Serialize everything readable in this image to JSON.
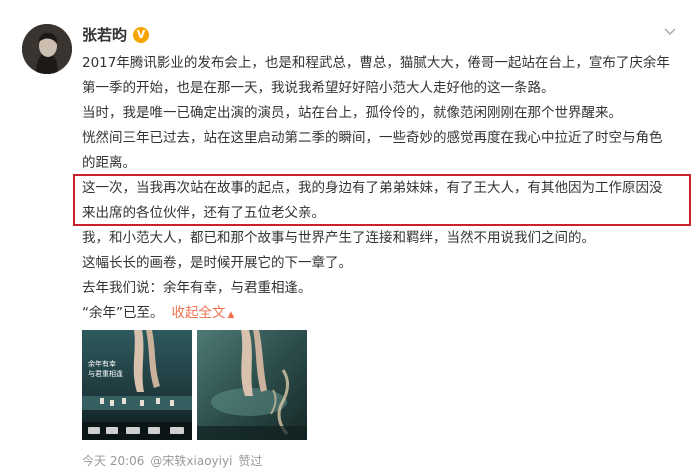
{
  "post": {
    "author": "张若昀",
    "badge": "V",
    "paragraphs": [
      "2017年腾讯影业的发布会上，也是和程武总，曹总，猫腻大大，倦哥一起站在台上，宣布了庆余年第一季的开始，也是在那一天，我说我希望好好陪小范大人走好他的这一条路。",
      "当时，我是唯一已确定出演的演员，站在台上，孤伶伶的，就像范闲刚刚在那个世界醒来。",
      "恍然间三年已过去，站在这里启动第二季的瞬间，一些奇妙的感觉再度在我心中拉近了时空与角色的距离。",
      "这一次，当我再次站在故事的起点，我的身边有了弟弟妹妹，有了王大人，有其他因为工作原因没来出席的各位伙伴，还有了五位老父亲。",
      "我，和小范大人，都已和那个故事与世界产生了连接和羁绊，当然不用说我们之间的。",
      "这幅长长的画卷，是时候开展它的下一章了。",
      "去年我们说：余年有幸，与君重相逢。"
    ],
    "last_line": "“余年”已至。",
    "collapse_link": "收起全文",
    "collapse_icon": "caret-up-icon"
  },
  "images": [
    {
      "name": "poster-hands-game",
      "text_lines": [
        "余年有幸",
        "与君重相逢"
      ]
    },
    {
      "name": "poster-hand-water"
    }
  ],
  "footer": {
    "time": "今天 20:06",
    "liker": "@宋轶xiaoyiyi",
    "action": "赞过"
  },
  "colors": {
    "link": "#eb7350",
    "highlight_border": "#c8232c",
    "badge": "#f7a400"
  }
}
